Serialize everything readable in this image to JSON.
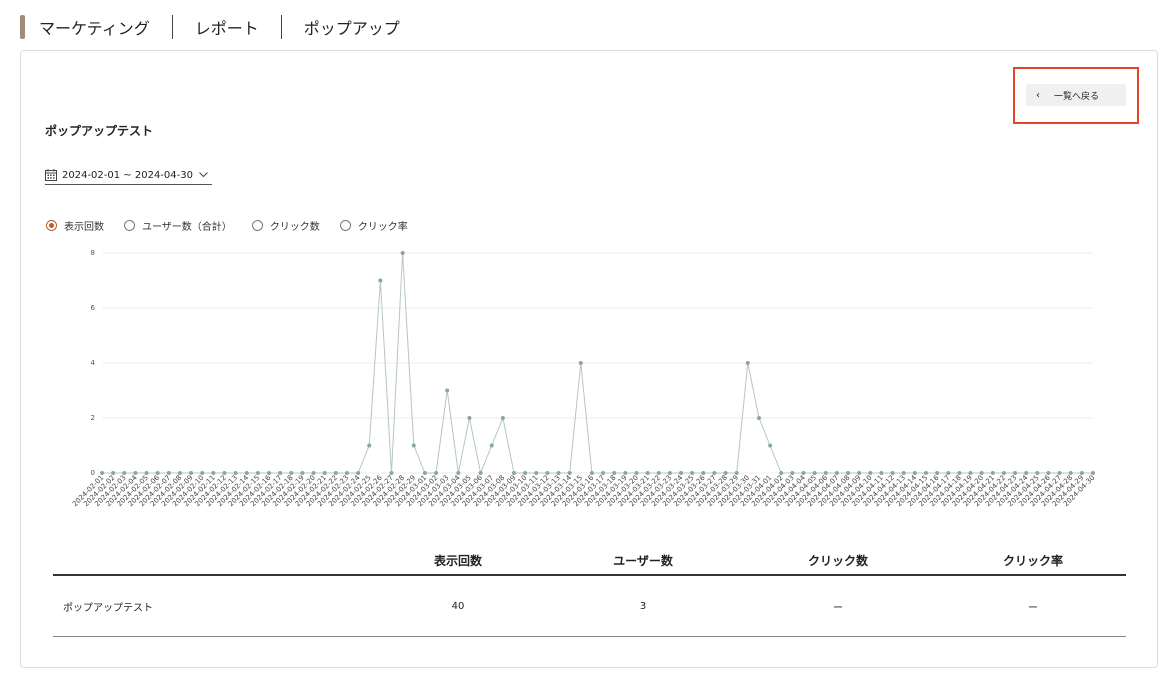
{
  "breadcrumb": [
    "マーケティング",
    "レポート",
    "ポップアップ"
  ],
  "back_button_label": "一覧へ戻る",
  "popup_title": "ポップアップテスト",
  "date_range": "2024-02-01 ~ 2024-04-30",
  "metrics": [
    {
      "label": "表示回数",
      "selected": true
    },
    {
      "label": "ユーザー数（合計）",
      "selected": false
    },
    {
      "label": "クリック数",
      "selected": false
    },
    {
      "label": "クリック率",
      "selected": false
    }
  ],
  "colors": {
    "accent": "#a08c79",
    "highlight": "#e5452a",
    "radio": "#c05a2a",
    "line": "#b8c6bf",
    "point": "#8aa89a"
  },
  "chart_data": {
    "type": "line",
    "x_start": "2024-02-01",
    "x_end": "2024-04-30",
    "y_ticks": [
      0,
      2,
      4,
      6,
      8
    ],
    "ylim": [
      0,
      8
    ],
    "series": [
      {
        "values": [
          0,
          0,
          0,
          0,
          0,
          0,
          0,
          0,
          0,
          0,
          0,
          0,
          0,
          0,
          0,
          0,
          0,
          0,
          0,
          0,
          0,
          0,
          0,
          0,
          1,
          7,
          0,
          8,
          1,
          0,
          0,
          3,
          0,
          2,
          0,
          1,
          2,
          0,
          0,
          0,
          0,
          0,
          0,
          4,
          0,
          0,
          0,
          0,
          0,
          0,
          0,
          0,
          0,
          0,
          0,
          0,
          0,
          0,
          4,
          2,
          1,
          0,
          0,
          0,
          0,
          0,
          0,
          0,
          0,
          0,
          0,
          0,
          0,
          0,
          0,
          0,
          0,
          0,
          0,
          0,
          0,
          0,
          0,
          0,
          0,
          0,
          0,
          0,
          0,
          0
        ]
      }
    ]
  },
  "table": {
    "headers": [
      "",
      "表示回数",
      "ユーザー数",
      "クリック数",
      "クリック率"
    ],
    "rows": [
      [
        "ポップアップテスト",
        "40",
        "3",
        "ー",
        "ー"
      ]
    ]
  }
}
